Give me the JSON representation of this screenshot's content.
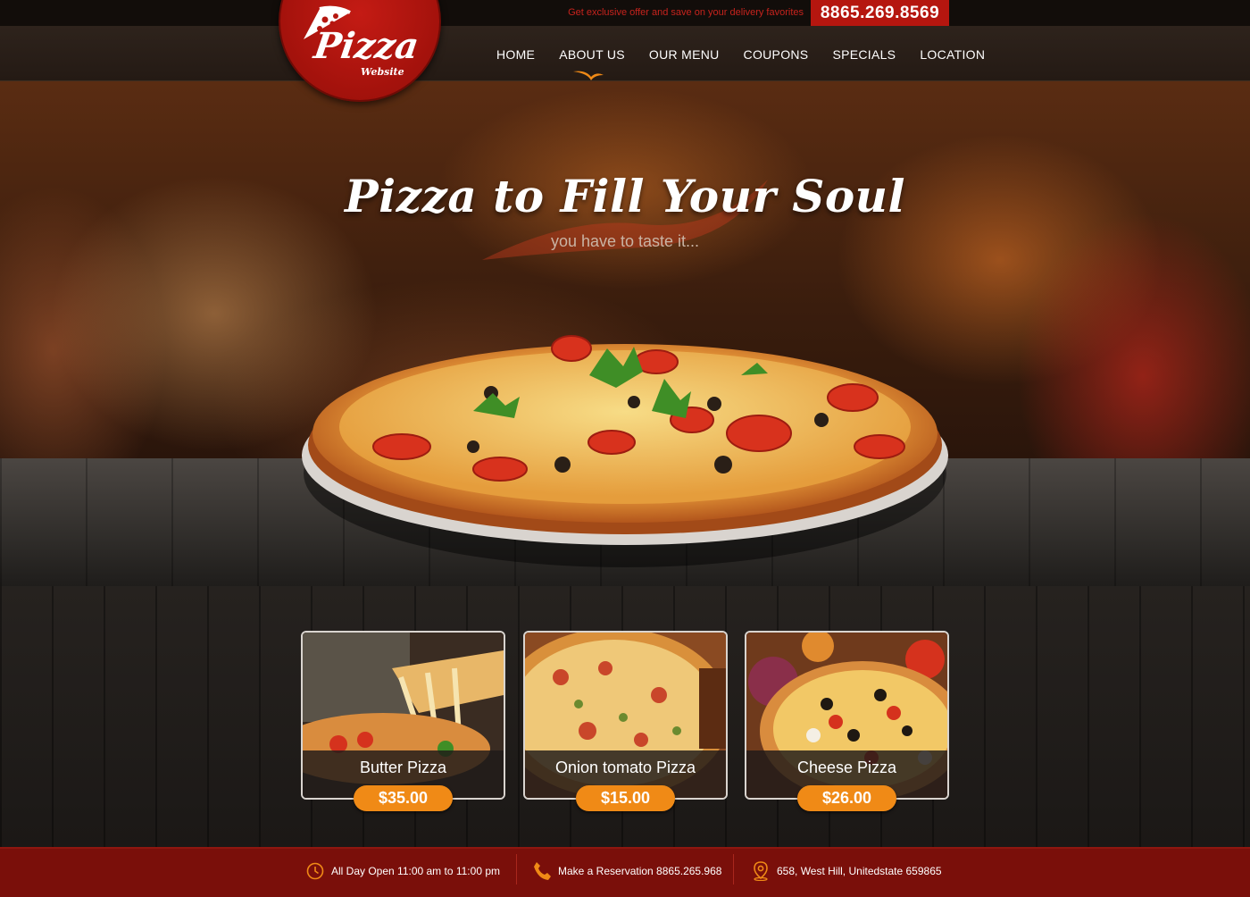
{
  "topbar": {
    "offer_text": "Get exclusive offer and save on your delivery favorites",
    "phone": "8865.269.8569"
  },
  "logo": {
    "title": "Pizza",
    "subtitle": "Website"
  },
  "nav": {
    "items": [
      "HOME",
      "ABOUT US",
      "OUR MENU",
      "COUPONS",
      "SPECIALS",
      "LOCATION"
    ],
    "active": "ABOUT US"
  },
  "hero": {
    "title": "Pizza to Fill Your Soul",
    "subtitle": "you have to taste it..."
  },
  "menu_cards": [
    {
      "name": "Butter Pizza",
      "price": "$35.00"
    },
    {
      "name": "Onion tomato Pizza",
      "price": "$15.00"
    },
    {
      "name": "Cheese Pizza",
      "price": "$26.00"
    }
  ],
  "footer": {
    "hours": "All Day Open 11:00 am to 11:00 pm",
    "reservation": "Make a Reservation 8865.265.968",
    "address": "658, West Hill, Unitedstate 659865",
    "icons": [
      "clock-icon",
      "phone-icon",
      "location-pin-icon"
    ]
  },
  "colors": {
    "brand_red": "#b5160f",
    "accent_orange": "#f08a16",
    "footer_red": "#7a0f0a"
  }
}
